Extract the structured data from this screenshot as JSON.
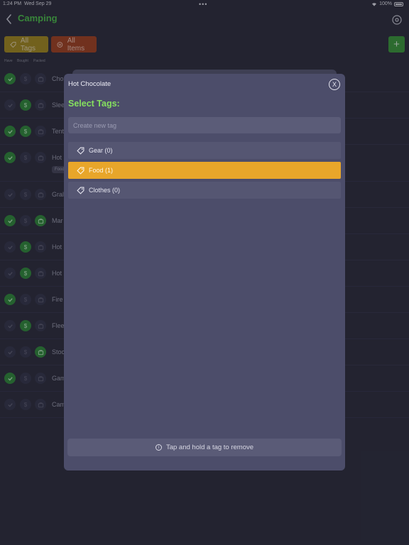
{
  "status": {
    "time": "1:24 PM",
    "date": "Wed Sep 29",
    "battery": "100%"
  },
  "nav": {
    "title": "Camping"
  },
  "filters": {
    "tags_label": "All Tags",
    "items_label": "All Items",
    "add_label": "+"
  },
  "columns": {
    "have": "Have",
    "bought": "Bought",
    "packed": "Packed"
  },
  "rows": [
    {
      "name": "Cho",
      "have": true,
      "bought": false,
      "packed": false
    },
    {
      "name": "Slee",
      "have": false,
      "bought": true,
      "packed": false
    },
    {
      "name": "Tent",
      "have": true,
      "bought": true,
      "packed": false
    },
    {
      "name": "Hot",
      "have": true,
      "bought": false,
      "packed": false,
      "tag": "Food"
    },
    {
      "name": "Gral",
      "have": false,
      "bought": false,
      "packed": false
    },
    {
      "name": "Mar",
      "have": true,
      "bought": false,
      "packed": true
    },
    {
      "name": "Hot",
      "have": false,
      "bought": true,
      "packed": false
    },
    {
      "name": "Hot",
      "have": false,
      "bought": true,
      "packed": false
    },
    {
      "name": "Fire",
      "have": true,
      "bought": false,
      "packed": false
    },
    {
      "name": "Flee",
      "have": false,
      "bought": true,
      "packed": false
    },
    {
      "name": "Stoc",
      "have": false,
      "bought": false,
      "packed": true
    },
    {
      "name": "Gam",
      "have": true,
      "bought": false,
      "packed": false
    },
    {
      "name": "Cam",
      "have": false,
      "bought": false,
      "packed": false
    }
  ],
  "modal": {
    "title": "Hot Chocolate",
    "close_label": "X",
    "heading": "Select Tags:",
    "new_tag_placeholder": "Create new tag",
    "tags": [
      {
        "label": "Gear (0)",
        "selected": false
      },
      {
        "label": "Food (1)",
        "selected": true
      },
      {
        "label": "Clothes (0)",
        "selected": false
      }
    ],
    "footer_hint": "Tap and hold a tag to remove"
  },
  "colors": {
    "accent_green": "#4cc24a",
    "selected_tag": "#e8a62a",
    "heading_green": "#86e05f"
  }
}
